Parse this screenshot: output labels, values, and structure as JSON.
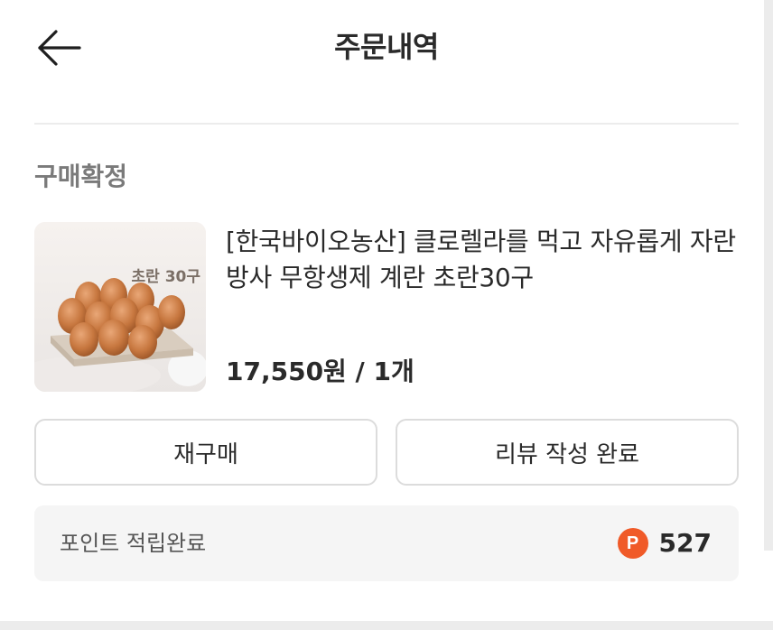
{
  "header": {
    "title": "주문내역",
    "back_icon": "arrow-left-icon"
  },
  "order": {
    "status": "구매확정",
    "product": {
      "image_badge": "초란 30구",
      "title": "[한국바이오농산] 클로렐라를 먹고 자유롭게 자란 방사 무항생제 계란 초란30구",
      "price": "17,550원 / 1개"
    },
    "actions": {
      "rebuy_label": "재구매",
      "review_label": "리뷰 작성 완료"
    },
    "points": {
      "label": "포인트 적립완료",
      "icon_letter": "P",
      "value": "527",
      "accent_color": "#f05a28"
    }
  }
}
